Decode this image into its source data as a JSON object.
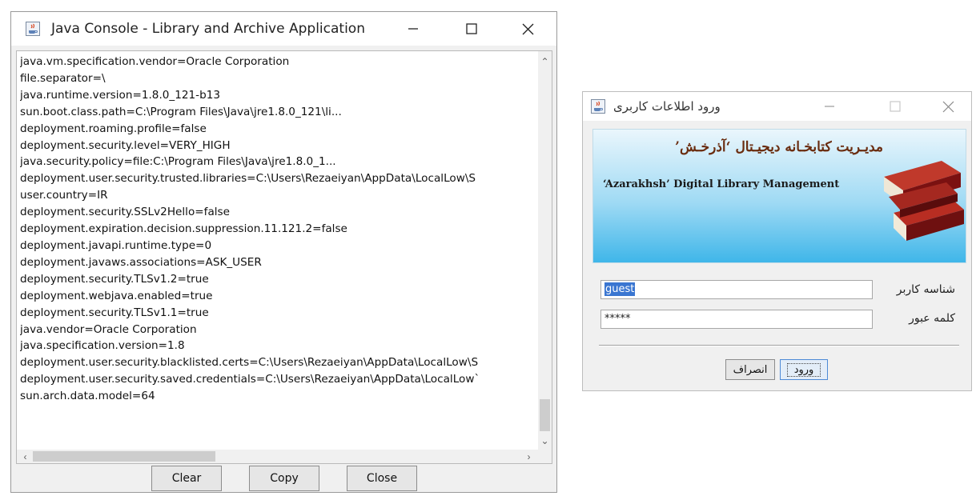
{
  "console": {
    "title": "Java Console - Library and Archive Application",
    "lines": [
      "java.vm.specification.vendor=Oracle Corporation",
      "file.separator=\\",
      "java.runtime.version=1.8.0_121-b13",
      "sun.boot.class.path=C:\\Program Files\\Java\\jre1.8.0_121\\li...",
      "deployment.roaming.profile=false",
      "deployment.security.level=VERY_HIGH",
      "java.security.policy=file:C:\\Program Files\\Java\\jre1.8.0_1...",
      "deployment.user.security.trusted.libraries=C:\\Users\\Rezaeiyan\\AppData\\LocalLow\\S",
      "user.country=IR",
      "deployment.security.SSLv2Hello=false",
      "deployment.expiration.decision.suppression.11.121.2=false",
      "deployment.javapi.runtime.type=0",
      "deployment.javaws.associations=ASK_USER",
      "deployment.security.TLSv1.2=true",
      "deployment.webjava.enabled=true",
      "deployment.security.TLSv1.1=true",
      "java.vendor=Oracle Corporation",
      "java.specification.version=1.8",
      "deployment.user.security.blacklisted.certs=C:\\Users\\Rezaeiyan\\AppData\\LocalLow\\S",
      "deployment.user.security.saved.credentials=C:\\Users\\Rezaeiyan\\AppData\\LocalLow`",
      "sun.arch.data.model=64"
    ],
    "buttons": {
      "clear": "Clear",
      "copy": "Copy",
      "close": "Close"
    }
  },
  "login": {
    "title": "ورود اطلاعات کاربری",
    "banner_fa": "مدیـریت کتابخـانه دیجیـتال ‘آذرخـش’",
    "banner_en": "‘Azarakhsh’ Digital Library Management",
    "username_label": "شناسه کاربر",
    "username_value": "guest",
    "password_label": "کلمه عبور",
    "password_value": "*****",
    "buttons": {
      "login": "ورود",
      "cancel": "انصراف"
    }
  },
  "icons": {
    "minimize": "minimize-icon",
    "maximize": "maximize-icon",
    "close": "close-icon",
    "app": "java-coffee-icon"
  },
  "colors": {
    "selection": "#3a76d1",
    "banner_title": "#6a2c0f",
    "banner_sky": "#3fb6e9"
  }
}
